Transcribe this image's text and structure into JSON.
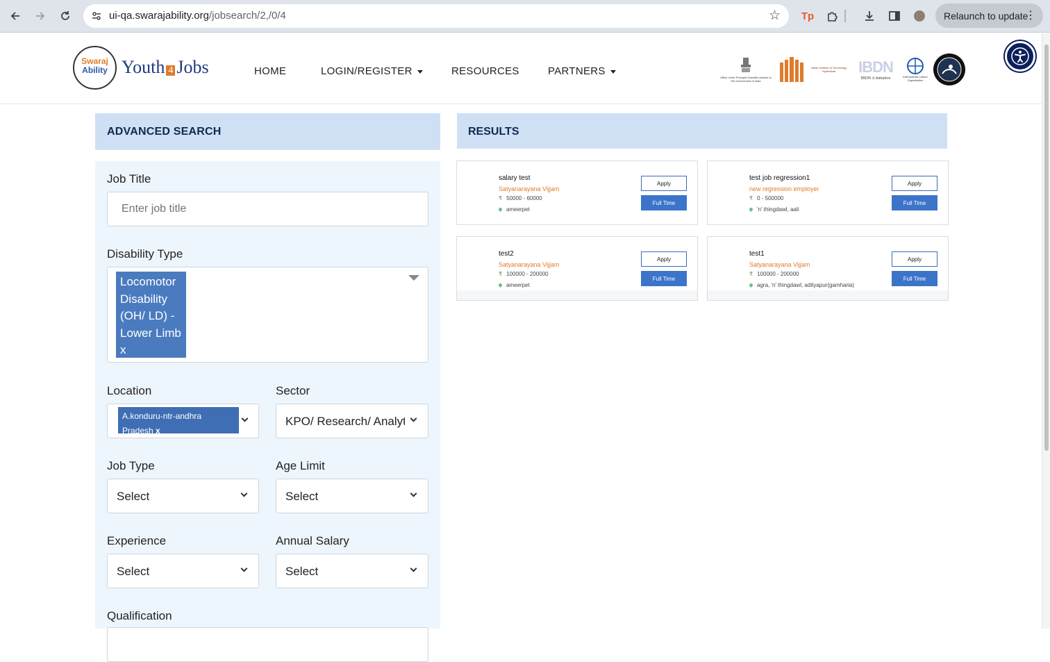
{
  "browser": {
    "url_host": "ui-qa.swarajability.org",
    "url_path": "/jobsearch/2,/0/4",
    "relaunch_label": "Relaunch to update"
  },
  "site": {
    "logo_line1": "Swaraj",
    "logo_line2": "Ability",
    "brand_left": "Youth",
    "brand_four": "4",
    "brand_right": "Jobs",
    "menu": {
      "home": "HOME",
      "login": "LOGIN/REGISTER",
      "resources": "RESOURCES",
      "partners": "PARTNERS"
    },
    "partners": [
      "Office of the Principal Scientific Adviser to the Government of India",
      "Indian Institute of Technology Hyderabad",
      "IBDN A Initiative",
      "International Labour Organization"
    ]
  },
  "search": {
    "heading": "ADVANCED SEARCH",
    "job_title_label": "Job Title",
    "job_title_placeholder": "Enter job title",
    "disability_label": "Disability Type",
    "disability_tag": "Locomotor Disability (OH/ LD) - Lower Limb",
    "tag_remove": "x",
    "location_label": "Location",
    "location_tag": "A.konduru-ntr-andhra Pradesh",
    "location_remove": "x",
    "sector_label": "Sector",
    "sector_value": "KPO/ Research/ Analytics",
    "job_type_label": "Job Type",
    "job_type_value": "Select",
    "age_label": "Age Limit",
    "age_value": "Select",
    "experience_label": "Experience",
    "experience_value": "Select",
    "salary_label": "Annual Salary",
    "salary_value": "Select",
    "qualification_label": "Qualification"
  },
  "results": {
    "heading": "RESULTS",
    "apply_label": "Apply",
    "fulltime_label": "Full Time",
    "rupee": "₹",
    "cards": [
      {
        "title": "salary test",
        "employer": "Satyanarayana Vijjam",
        "salary": "50000 - 60000",
        "location": "ameerpet"
      },
      {
        "title": "test job regression1",
        "employer": "new regression employer",
        "salary": "0 - 500000",
        "location": "'n' thingdawl, aali"
      },
      {
        "title": "test2",
        "employer": "Satyanarayana Vijjam",
        "salary": "100000 - 200000",
        "location": "ameerpet"
      },
      {
        "title": "test1",
        "employer": "Satyanarayana Vijjam",
        "salary": "100000 - 200000",
        "location": "agra, 'n' thingdawl, adityapur(gamharia)"
      }
    ]
  }
}
